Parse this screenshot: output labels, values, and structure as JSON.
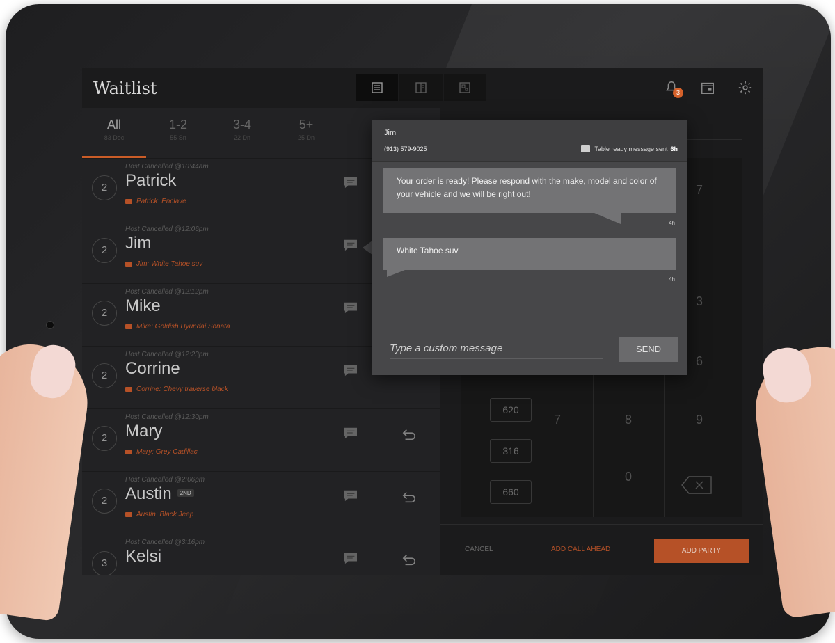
{
  "app": {
    "title": "Waitlist"
  },
  "filters": [
    {
      "label": "All",
      "sub": "83 Dec"
    },
    {
      "label": "1-2",
      "sub": "55 Sn"
    },
    {
      "label": "3-4",
      "sub": "22 Dn"
    },
    {
      "label": "5+",
      "sub": "25 Dn"
    }
  ],
  "notifications": {
    "count": "3"
  },
  "waitlist": [
    {
      "size": "2",
      "name": "Patrick",
      "tag": "",
      "status": "Host Cancelled @10:44am",
      "note": "Patrick: Enclave"
    },
    {
      "size": "2",
      "name": "Jim",
      "tag": "",
      "status": "Host Cancelled @12:06pm",
      "note": "Jim: White Tahoe suv"
    },
    {
      "size": "2",
      "name": "Mike",
      "tag": "",
      "status": "Host Cancelled @12:12pm",
      "note": "Mike: Goldish Hyundai Sonata"
    },
    {
      "size": "2",
      "name": "Corrine",
      "tag": "",
      "status": "Host Cancelled @12:23pm",
      "note": "Corrine: Chevy traverse black"
    },
    {
      "size": "2",
      "name": "Mary",
      "tag": "",
      "status": "Host Cancelled @12:30pm",
      "note": "Mary: Grey Cadillac"
    },
    {
      "size": "2",
      "name": "Austin",
      "tag": "2ND",
      "status": "Host Cancelled @2:06pm",
      "note": "Austin: Black Jeep"
    },
    {
      "size": "3",
      "name": "Kelsi",
      "tag": "",
      "status": "Host Cancelled @3:16pm",
      "note": ""
    }
  ],
  "keypad": {
    "keys": [
      "7",
      "3",
      "6",
      "7",
      "8",
      "9",
      "0"
    ],
    "tables": [
      "620",
      "316",
      "660"
    ]
  },
  "actions": {
    "cancel": "CANCEL",
    "add_call_ahead": "ADD CALL AHEAD",
    "add_party": "ADD PARTY"
  },
  "popup": {
    "name": "Jim",
    "phone": "(913) 579-9025",
    "status_text": "Table ready message sent",
    "status_time": "6h",
    "messages": [
      {
        "text": "Your order is ready! Please respond with the make, model and color of your vehicle and we will be right out!",
        "time": "4h"
      },
      {
        "text": "White Tahoe suv",
        "time": "4h"
      }
    ],
    "input_placeholder": "Type a custom message",
    "send_label": "SEND"
  },
  "colors": {
    "accent": "#c0562a",
    "screen_bg": "#222224",
    "popup_bg": "#474749"
  }
}
